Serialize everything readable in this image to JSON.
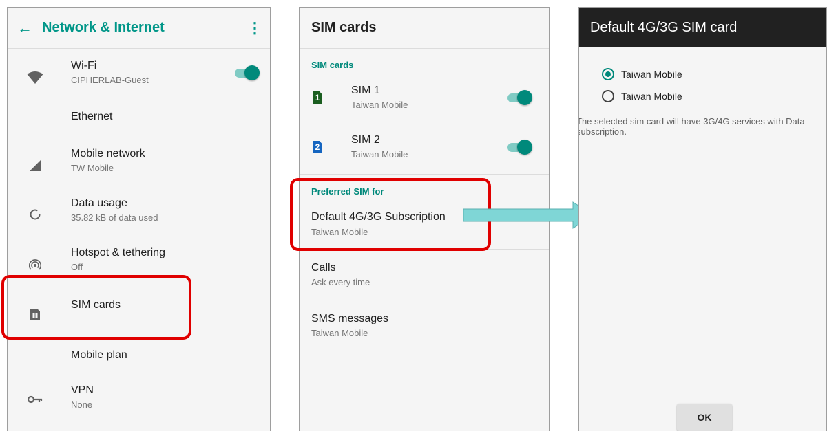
{
  "network_screen": {
    "title": "Network & Internet",
    "items": [
      {
        "title": "Wi-Fi",
        "subtitle": "CIPHERLAB-Guest",
        "icon": "wifi-icon",
        "toggle": true
      },
      {
        "title": "Ethernet",
        "subtitle": "",
        "icon": ""
      },
      {
        "title": "Mobile network",
        "subtitle": "TW Mobile",
        "icon": "signal-icon"
      },
      {
        "title": "Data usage",
        "subtitle": "35.82 kB of data used",
        "icon": "data-usage-icon"
      },
      {
        "title": "Hotspot & tethering",
        "subtitle": "Off",
        "icon": "hotspot-icon"
      },
      {
        "title": "SIM cards",
        "subtitle": "",
        "icon": "sim-card-icon"
      },
      {
        "title": "Mobile plan",
        "subtitle": "",
        "icon": ""
      },
      {
        "title": "VPN",
        "subtitle": "None",
        "icon": "key-icon"
      }
    ]
  },
  "sim_screen": {
    "title": "SIM cards",
    "section_sims": "SIM cards",
    "sims": [
      {
        "title": "SIM 1",
        "subtitle": "Taiwan Mobile",
        "badge": "1",
        "badge_color": "#1b5e20",
        "enabled": true
      },
      {
        "title": "SIM 2",
        "subtitle": "Taiwan Mobile",
        "badge": "2",
        "badge_color": "#1565c0",
        "enabled": true
      }
    ],
    "section_preferred": "Preferred SIM for",
    "preferred": [
      {
        "title": "Default 4G/3G Subscription",
        "subtitle": "Taiwan Mobile"
      },
      {
        "title": "Calls",
        "subtitle": "Ask every time"
      },
      {
        "title": "SMS messages",
        "subtitle": "Taiwan Mobile"
      }
    ]
  },
  "dialog_screen": {
    "title": "Default 4G/3G SIM card",
    "options": [
      {
        "label": "Taiwan Mobile",
        "selected": true
      },
      {
        "label": "Taiwan Mobile",
        "selected": false
      }
    ],
    "description": "The selected sim card will have 3G/4G services with Data subscription.",
    "ok_label": "OK"
  },
  "colors": {
    "accent": "#00897b",
    "highlight": "#e00000",
    "arrow": "#7fd6d6"
  }
}
